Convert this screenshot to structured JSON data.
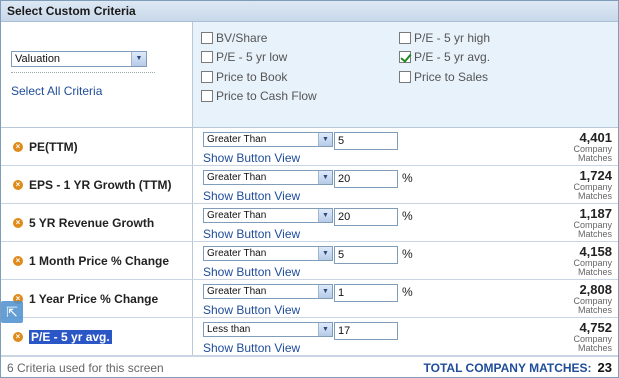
{
  "title": "Select Custom Criteria",
  "category_select": {
    "value": "Valuation"
  },
  "select_all_label": "Select All Criteria",
  "criteria_options": [
    [
      {
        "label": "BV/Share",
        "checked": false
      },
      {
        "label": "P/E - 5 yr low",
        "checked": false
      },
      {
        "label": "Price to Book",
        "checked": false
      },
      {
        "label": "Price to Cash Flow",
        "checked": false
      }
    ],
    [
      {
        "label": "P/E - 5 yr high",
        "checked": false
      },
      {
        "label": "P/E - 5 yr avg.",
        "checked": true
      },
      {
        "label": "Price to Sales",
        "checked": false
      }
    ]
  ],
  "rows": [
    {
      "name": "PE(TTM)",
      "operator": "Greater Than",
      "value": "5",
      "unit": "",
      "show_label": "Show Button View",
      "count": "4,401",
      "count_label_1": "Company",
      "count_label_2": "Matches",
      "highlighted": false
    },
    {
      "name": "EPS - 1 YR Growth (TTM)",
      "operator": "Greater Than",
      "value": "20",
      "unit": "%",
      "show_label": "Show Button View",
      "count": "1,724",
      "count_label_1": "Company",
      "count_label_2": "Matches",
      "highlighted": false
    },
    {
      "name": "5 YR Revenue Growth",
      "operator": "Greater Than",
      "value": "20",
      "unit": "%",
      "show_label": "Show Button View",
      "count": "1,187",
      "count_label_1": "Company",
      "count_label_2": "Matches",
      "highlighted": false
    },
    {
      "name": "1 Month Price % Change",
      "operator": "Greater Than",
      "value": "5",
      "unit": "%",
      "show_label": "Show Button View",
      "count": "4,158",
      "count_label_1": "Company",
      "count_label_2": "Matches",
      "highlighted": false
    },
    {
      "name": "1 Year Price % Change",
      "operator": "Greater Than",
      "value": "1",
      "unit": "%",
      "show_label": "Show Button View",
      "count": "2,808",
      "count_label_1": "Company",
      "count_label_2": "Matches",
      "highlighted": false
    },
    {
      "name": "P/E - 5 yr avg.",
      "operator": "Less than",
      "value": "17",
      "unit": "",
      "show_label": "Show Button View",
      "count": "4,752",
      "count_label_1": "Company",
      "count_label_2": "Matches",
      "highlighted": true
    }
  ],
  "footer": {
    "criteria_used": "6 Criteria used for this screen",
    "total_label": "TOTAL COMPANY MATCHES:",
    "total_value": "23"
  },
  "icons": {
    "remove": "remove-x-icon",
    "dropdown": "chevron-down-icon",
    "resize": "expand-arrow-icon"
  },
  "colors": {
    "accent_link": "#1f4d9a",
    "remove_icon": "#e08a1a",
    "highlight": "#2a56c6"
  }
}
